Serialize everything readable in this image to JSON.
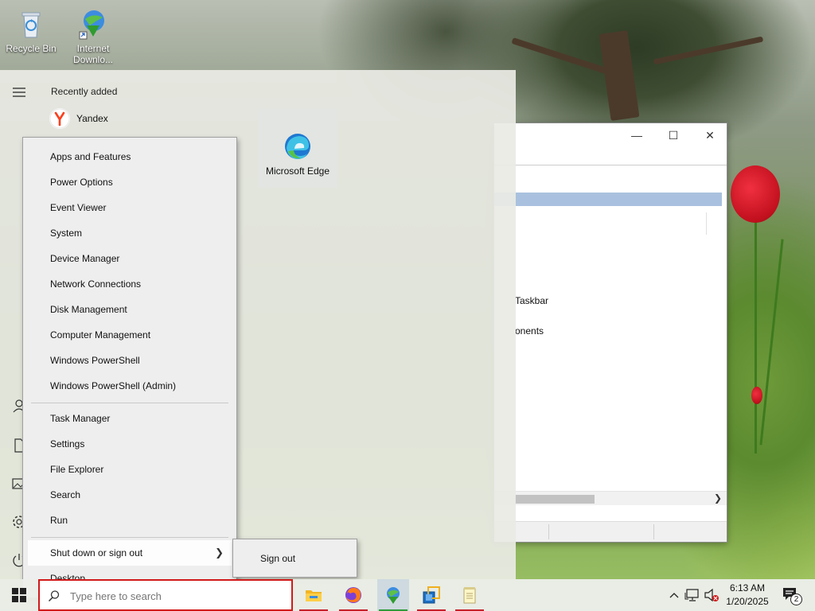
{
  "desktop": {
    "icons": [
      {
        "label": "Recycle Bin",
        "icon": "recycle-bin-icon"
      },
      {
        "label": "Internet Downlo...",
        "icon": "internet-download-manager-icon"
      }
    ]
  },
  "background_window": {
    "controls": {
      "minimize": "—",
      "maximize": "☐",
      "close": "✕"
    },
    "partial_text": [
      "Taskbar",
      "onents"
    ]
  },
  "start_menu": {
    "section_header": "Recently added",
    "recent_apps": [
      {
        "label": "Yandex",
        "icon": "yandex-icon"
      }
    ],
    "tiles": [
      {
        "label": "Microsoft Edge",
        "icon": "edge-icon"
      }
    ],
    "rail_icons": [
      "hamburger-menu-icon",
      "user-icon",
      "document-icon",
      "pictures-icon",
      "settings-icon",
      "power-icon"
    ]
  },
  "context_menu": {
    "group1": [
      "Apps and Features",
      "Power Options",
      "Event Viewer",
      "System",
      "Device Manager",
      "Network Connections",
      "Disk Management",
      "Computer Management",
      "Windows PowerShell",
      "Windows PowerShell (Admin)"
    ],
    "group2": [
      "Task Manager",
      "Settings",
      "File Explorer",
      "Search",
      "Run"
    ],
    "group3": [
      {
        "label": "Shut down or sign out",
        "has_submenu": true,
        "highlighted": true
      },
      {
        "label": "Desktop",
        "has_submenu": false
      }
    ],
    "submenu": [
      "Sign out"
    ]
  },
  "taskbar": {
    "search_placeholder": "Type here to search",
    "apps": [
      "file-explorer-icon",
      "firefox-icon",
      "internet-download-manager-icon",
      "virtualbox-icon",
      "notepad-icon"
    ],
    "tray": {
      "clock_time": "6:13 AM",
      "clock_date": "1/20/2025",
      "notification_count": "2"
    }
  },
  "colors": {
    "accent_red": "#d11a1a",
    "selection_blue": "#a9c1de"
  }
}
